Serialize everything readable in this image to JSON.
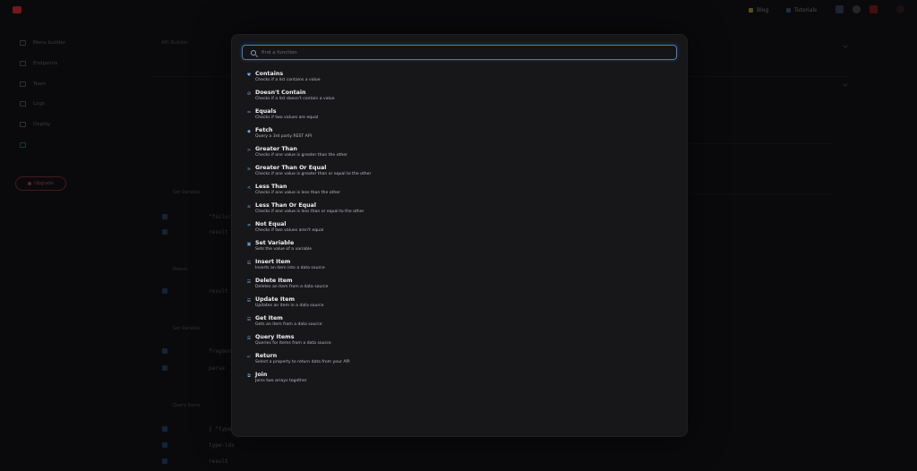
{
  "topbar": {
    "logo_text": "",
    "links": [
      {
        "label": "Blog",
        "icon": "bolt-icon"
      },
      {
        "label": "Tutorials",
        "icon": "star-icon"
      }
    ],
    "icons": [
      {
        "name": "discord-icon",
        "color": "#3a3f6a"
      },
      {
        "name": "github-icon",
        "color": "#4a4a50"
      },
      {
        "name": "youtube-icon",
        "color": "#7a1a1a"
      },
      {
        "name": "avatar-icon",
        "color": "#3a1a1a"
      }
    ]
  },
  "sidebar": {
    "items": [
      {
        "label": "Menu builder",
        "active": false
      },
      {
        "label": "Endpoints",
        "active": false
      },
      {
        "label": "Team",
        "active": false
      },
      {
        "label": "Logs",
        "active": false
      },
      {
        "label": "Deploy",
        "active": false
      },
      {
        "label": "",
        "active": true
      }
    ],
    "upgrade_label": "Upgrade"
  },
  "background": {
    "title": "API Builder",
    "subtitle": "",
    "blocks": [
      {
        "title": "Set Variable",
        "rows": [
          {
            "key": "",
            "val": "\"failure\""
          },
          {
            "key": "",
            "val": "result"
          }
        ]
      },
      {
        "title": "Return",
        "rows": [
          {
            "key": "",
            "val": "result"
          }
        ]
      },
      {
        "title": "Set Variable",
        "rows": [
          {
            "key": "",
            "val": "fragment"
          },
          {
            "key": "",
            "val": "parse"
          }
        ]
      },
      {
        "title": "Query Items",
        "rows": [
          {
            "key": "",
            "val": "{ \"type\""
          },
          {
            "key": "",
            "val": "type-ids"
          },
          {
            "key": "",
            "val": "result"
          }
        ]
      }
    ]
  },
  "palette": {
    "search_placeholder": "find a function",
    "accent_color": "#3f7fc0",
    "functions": [
      {
        "name": "Contains",
        "desc": "Checks if a list contains a value",
        "icon": "heart-icon",
        "glyph": "♥"
      },
      {
        "name": "Doesn't Contain",
        "desc": "Checks if a list doesn't contain a value",
        "icon": "circle-slash-icon",
        "glyph": "⊘"
      },
      {
        "name": "Equals",
        "desc": "Checks if two values are equal",
        "icon": "equals-icon",
        "glyph": "="
      },
      {
        "name": "Fetch",
        "desc": "Query a 3rd party REST API",
        "icon": "drop-icon",
        "glyph": "◆"
      },
      {
        "name": "Greater Than",
        "desc": "Checks if one value is greater than the other",
        "icon": "greater-than-icon",
        "glyph": ">"
      },
      {
        "name": "Greater Than Or Equal",
        "desc": "Checks if one value is greater than or equal to the other",
        "icon": "greater-equal-icon",
        "glyph": "≥"
      },
      {
        "name": "Less Than",
        "desc": "Checks if one value is less than the other",
        "icon": "less-than-icon",
        "glyph": "<"
      },
      {
        "name": "Less Than Or Equal",
        "desc": "Checks if one value is less than or equal to the other",
        "icon": "less-equal-icon",
        "glyph": "≤"
      },
      {
        "name": "Not Equal",
        "desc": "Checks if two values aren't equal",
        "icon": "not-equal-icon",
        "glyph": "≠"
      },
      {
        "name": "Set Variable",
        "desc": "Sets the value of a variable",
        "icon": "variable-icon",
        "glyph": "▣"
      },
      {
        "name": "Insert Item",
        "desc": "Inserts an item into a data source",
        "icon": "insert-icon",
        "glyph": "☰"
      },
      {
        "name": "Delete Item",
        "desc": "Deletes an item from a data source",
        "icon": "delete-icon",
        "glyph": "☰"
      },
      {
        "name": "Update Item",
        "desc": "Updates an item in a data source",
        "icon": "update-icon",
        "glyph": "☰"
      },
      {
        "name": "Get Item",
        "desc": "Gets an item from a data source",
        "icon": "get-icon",
        "glyph": "☰"
      },
      {
        "name": "Query Items",
        "desc": "Queries for items from a data source",
        "icon": "query-icon",
        "glyph": "☰"
      },
      {
        "name": "Return",
        "desc": "Select a property to return data from your API",
        "icon": "return-icon",
        "glyph": "↵"
      },
      {
        "name": "Join",
        "desc": "Joins two arrays together",
        "icon": "join-icon",
        "glyph": "⧉"
      }
    ]
  }
}
